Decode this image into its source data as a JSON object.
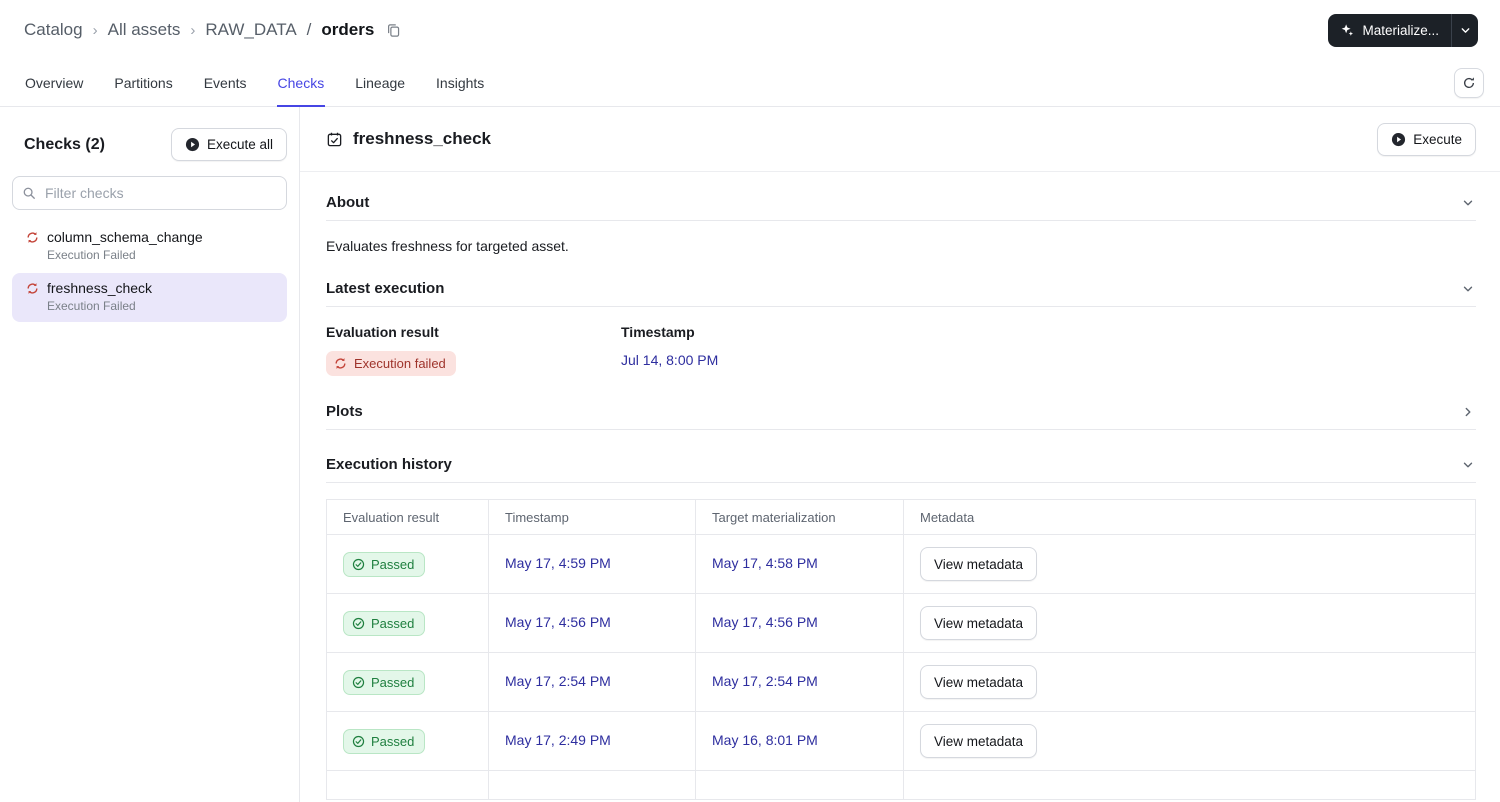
{
  "colors": {
    "accent": "#4645e4",
    "selected_bg": "#eae7fa",
    "error_bg": "#fbe2df",
    "error_text": "#9e332b",
    "error_icon": "#c4453a",
    "success_bg": "#e3f7e9",
    "success_border": "#b9e6c5",
    "success_text": "#1f7f3f",
    "link": "#2e2e9f",
    "dark_button_bg": "#1c2127"
  },
  "breadcrumb": {
    "items": [
      "Catalog",
      "All assets",
      "RAW_DATA"
    ],
    "current": "orders"
  },
  "header": {
    "materialize_label": "Materialize..."
  },
  "tabs": [
    {
      "label": "Overview",
      "active": false
    },
    {
      "label": "Partitions",
      "active": false
    },
    {
      "label": "Events",
      "active": false
    },
    {
      "label": "Checks",
      "active": true
    },
    {
      "label": "Lineage",
      "active": false
    },
    {
      "label": "Insights",
      "active": false
    }
  ],
  "sidebar": {
    "title": "Checks (2)",
    "execute_all_label": "Execute all",
    "filter_placeholder": "Filter checks",
    "items": [
      {
        "name": "column_schema_change",
        "status": "Execution Failed",
        "selected": false
      },
      {
        "name": "freshness_check",
        "status": "Execution Failed",
        "selected": true
      }
    ]
  },
  "main": {
    "title": "freshness_check",
    "execute_label": "Execute",
    "about": {
      "heading": "About",
      "description": "Evaluates freshness for targeted asset.",
      "expanded": true
    },
    "latest_execution": {
      "heading": "Latest execution",
      "evaluation_result_label": "Evaluation result",
      "evaluation_result": "Execution failed",
      "timestamp_label": "Timestamp",
      "timestamp": "Jul 14, 8:00 PM",
      "expanded": true
    },
    "plots": {
      "heading": "Plots",
      "expanded": false
    },
    "execution_history": {
      "heading": "Execution history",
      "expanded": true,
      "columns": [
        "Evaluation result",
        "Timestamp",
        "Target materialization",
        "Metadata"
      ],
      "rows": [
        {
          "result": "Passed",
          "timestamp": "May 17, 4:59 PM",
          "target": "May 17, 4:58 PM",
          "metadata_label": "View metadata"
        },
        {
          "result": "Passed",
          "timestamp": "May 17, 4:56 PM",
          "target": "May 17, 4:56 PM",
          "metadata_label": "View metadata"
        },
        {
          "result": "Passed",
          "timestamp": "May 17, 2:54 PM",
          "target": "May 17, 2:54 PM",
          "metadata_label": "View metadata"
        },
        {
          "result": "Passed",
          "timestamp": "May 17, 2:49 PM",
          "target": "May 16, 8:01 PM",
          "metadata_label": "View metadata"
        }
      ]
    }
  },
  "icons": {
    "materialize-sparkle": "sparkle",
    "copy-asset-key": "copy",
    "refresh": "circular-arrow",
    "search": "magnifier",
    "check-error": "sync-arrows-red",
    "asset-check-title": "calendar-check",
    "execute-play": "play-circle",
    "passed": "check-circle",
    "section-expanded": "chevron-down",
    "section-collapsed": "chevron-right",
    "materialize-caret": "chevron-down"
  }
}
